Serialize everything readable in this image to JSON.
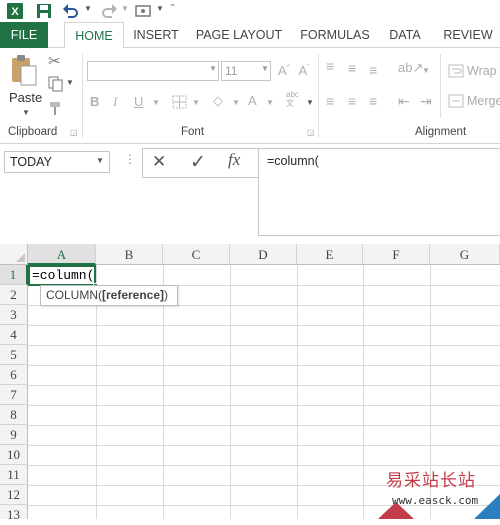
{
  "tabs": [
    "FILE",
    "HOME",
    "INSERT",
    "PAGE LAYOUT",
    "FORMULAS",
    "DATA",
    "REVIEW"
  ],
  "ribbon": {
    "paste_label": "Paste",
    "font_size": "11",
    "wrap_label": "Wrap",
    "merge_label": "Merge",
    "groups": {
      "clipboard": "Clipboard",
      "font": "Font",
      "alignment": "Alignment"
    }
  },
  "formula_bar": {
    "name_box": "TODAY",
    "cancel_icon": "✕",
    "enter_icon": "✓",
    "fx_label": "fx",
    "content": "=column("
  },
  "sheet": {
    "columns": [
      "A",
      "B",
      "C",
      "D",
      "E",
      "F",
      "G"
    ],
    "rows": [
      "1",
      "2",
      "3",
      "4",
      "5",
      "6",
      "7",
      "8",
      "9",
      "10",
      "11",
      "12",
      "13"
    ],
    "active_cell_text": "=column(",
    "tooltip": {
      "func": "COLUMN(",
      "arg": "[reference]",
      "close": ")"
    }
  },
  "watermark": {
    "title": "易采站长站",
    "url": "www.easck.com"
  },
  "colors": {
    "accent": "#217346"
  }
}
